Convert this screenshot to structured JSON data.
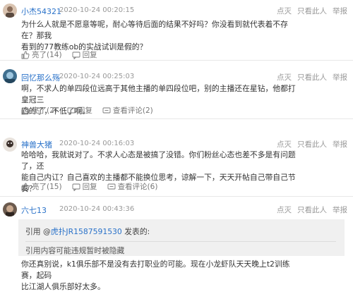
{
  "comments": [
    {
      "user": "小杰54321",
      "time": "2020-10-24 00:20:15",
      "actions": [
        "点灭",
        "只看此人",
        "举报"
      ],
      "body_lines": [
        "为什么人就是不愿意等呢，耐心等待后面的结果不好吗？你没看到就代表着不存在？那我",
        "看到的77教练ob的实战试训是假的？"
      ],
      "like_label": "亮了(14)",
      "reply_label": "回复"
    },
    {
      "user": "回忆那么殇",
      "time": "2020-10-24 00:25:03",
      "actions": [
        "点灭",
        "只看此人",
        "举报"
      ],
      "body_lines": [
        "啊，不求人的单四段位远高于其他主播的单四段位吧，别的主播还在星钻，他都打皇冠三",
        "四的了，不低了啊。"
      ],
      "like_label": "亮了(2)",
      "reply_label": "回复",
      "view_label": "查看评论(2)"
    },
    {
      "user": "神兽大猪",
      "time": "2020-10-24 00:16:03",
      "actions": [
        "点灭",
        "只看此人",
        "举报"
      ],
      "body_lines": [
        "哈哈哈，我就说对了。不求人心态是被搞了没错。你们粉丝心态也差不多是有问题了，还",
        "能自己内讧？自己喜欢的主播都不能换位思考，谅解一下，天天开帖自己带自己节奏？"
      ],
      "like_label": "亮了(15)",
      "reply_label": "回复",
      "view_label": "查看评论(6)"
    },
    {
      "user": "六七13",
      "time": "2020-10-24 00:43:36",
      "actions": [
        "点灭",
        "只看此人",
        "举报"
      ],
      "quote": {
        "prefix": "引用 @",
        "link": "虎扑JR1587591530",
        "suffix": " 发表的:",
        "body": "引用内容可能违规暂时被隐藏"
      },
      "body_lines": [
        "你还真别说，k1俱乐部不是没有去打职业的可能。现在小龙虾队天天晚上t2训练赛，起码",
        "比江湖人俱乐部好太多。"
      ]
    }
  ],
  "colors": {
    "link_blue": "#2a72c9",
    "meta_gray": "#999999",
    "quote_bg": "#f0f0f0"
  }
}
